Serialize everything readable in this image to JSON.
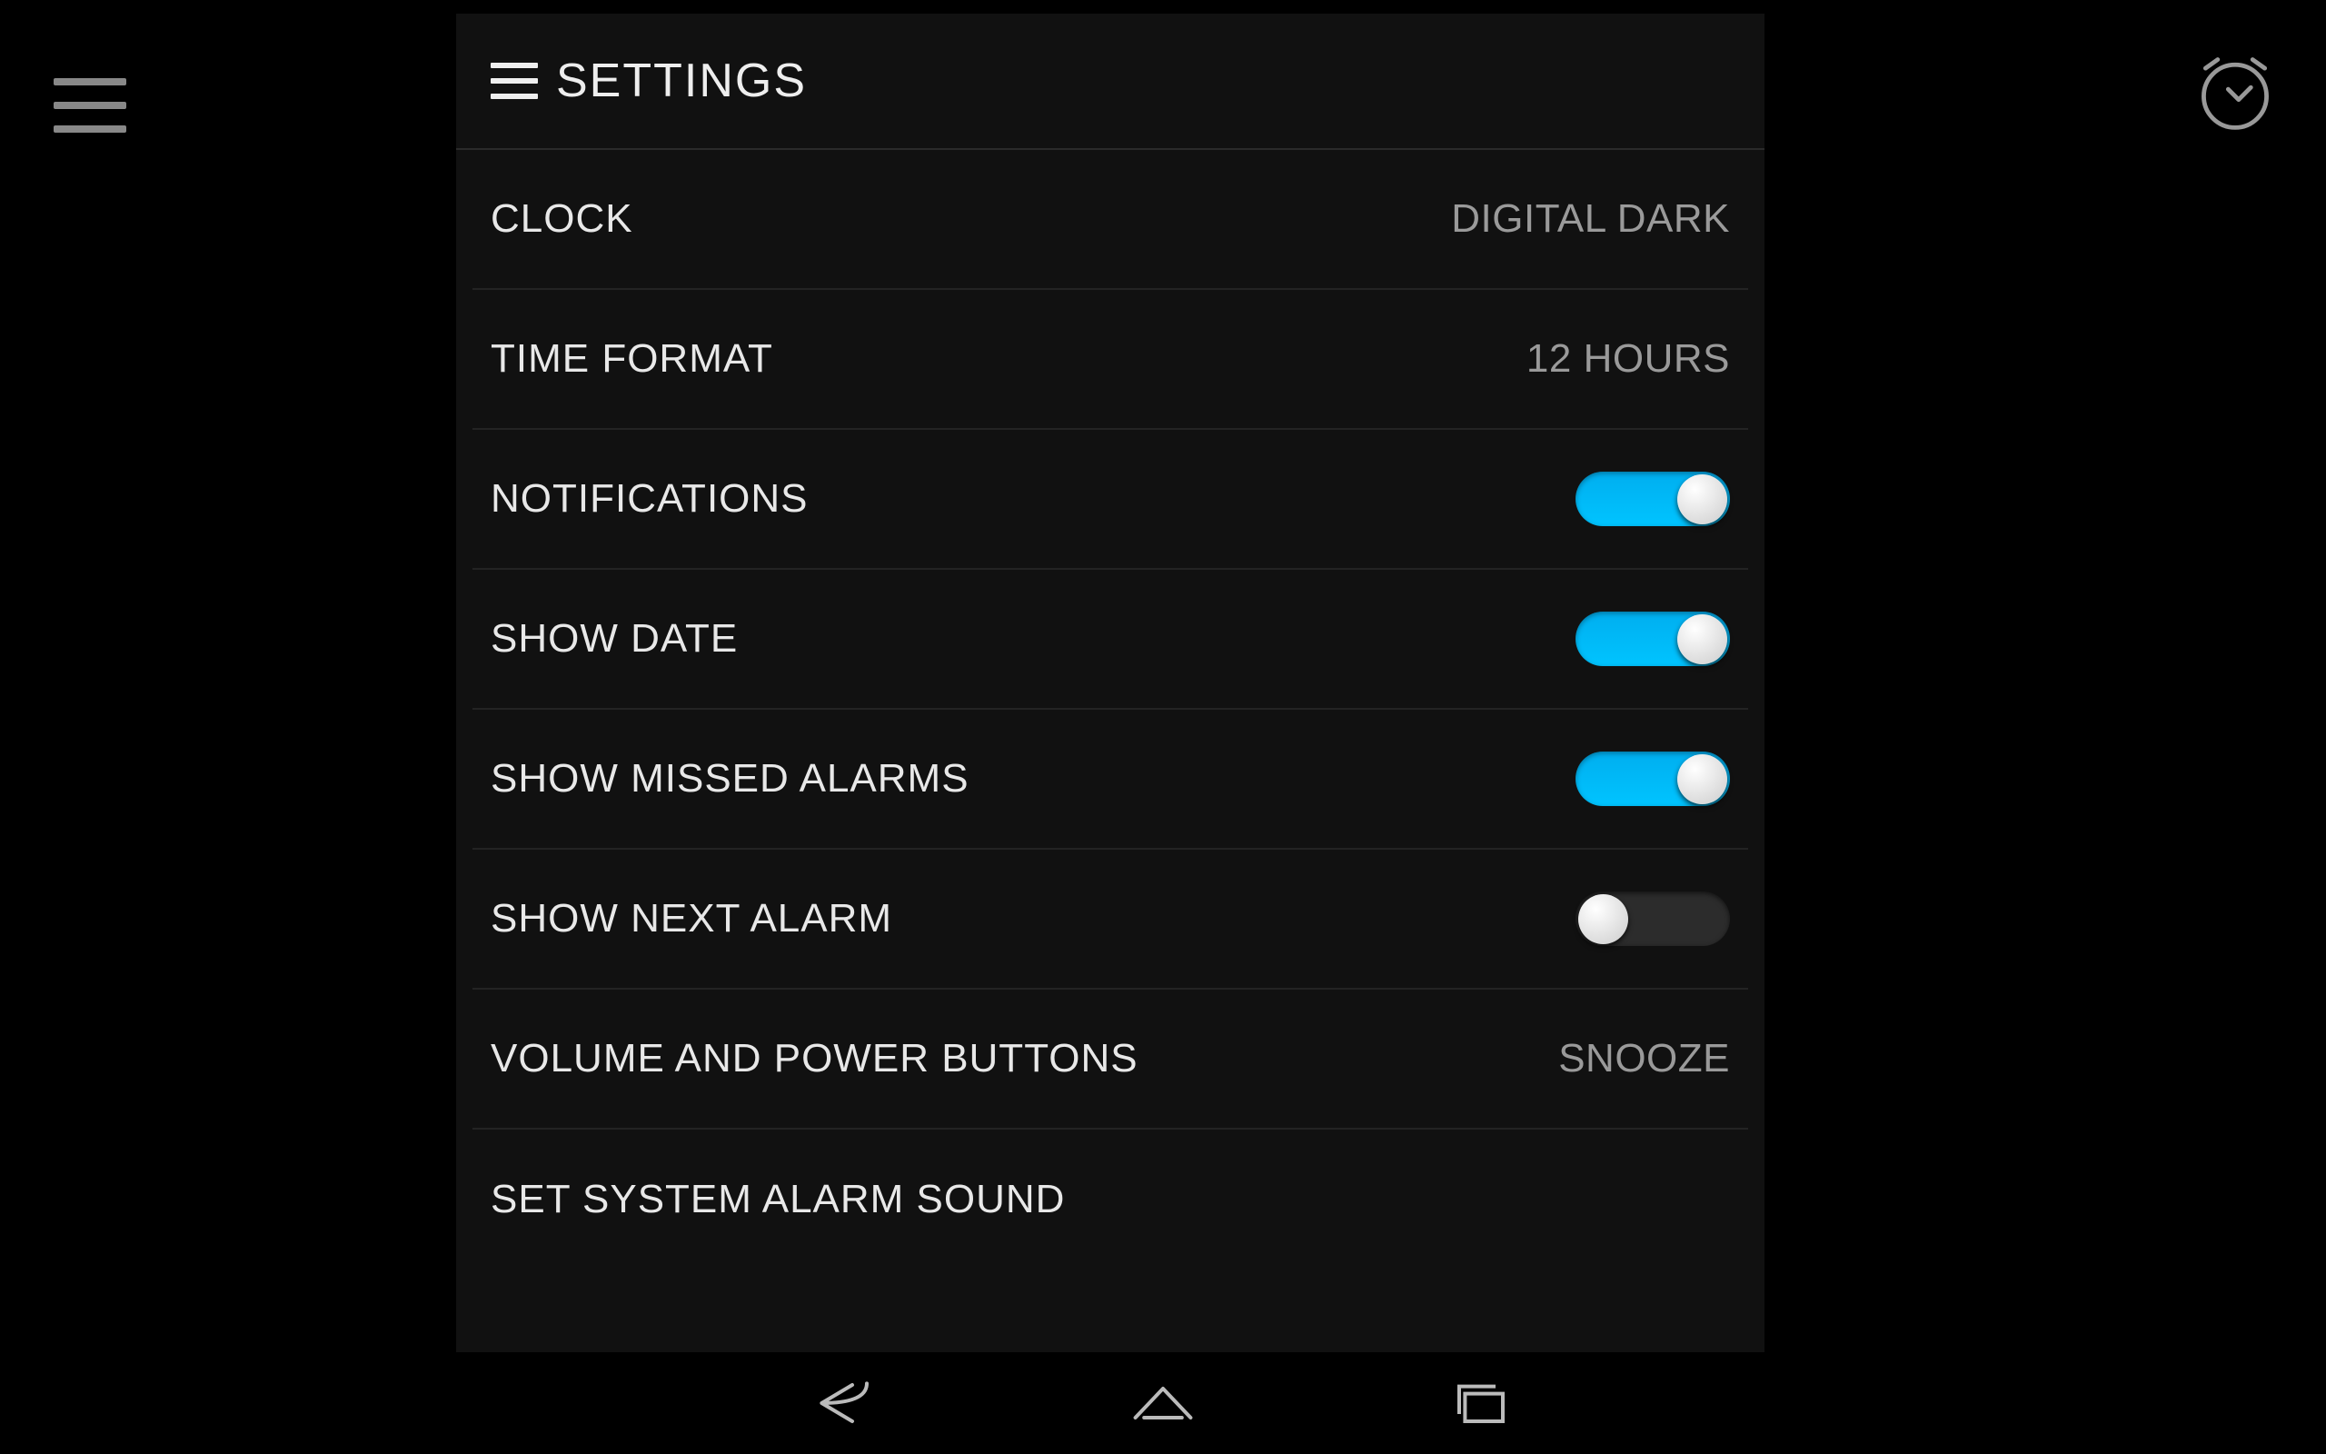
{
  "header": {
    "title": "SETTINGS"
  },
  "rows": {
    "clock": {
      "label": "CLOCK",
      "value": "DIGITAL DARK"
    },
    "time_format": {
      "label": "TIME FORMAT",
      "value": "12 HOURS"
    },
    "notifications": {
      "label": "NOTIFICATIONS",
      "on": true
    },
    "show_date": {
      "label": "SHOW DATE",
      "on": true
    },
    "show_missed": {
      "label": "SHOW MISSED ALARMS",
      "on": true
    },
    "show_next": {
      "label": "SHOW NEXT ALARM",
      "on": false
    },
    "vol_power": {
      "label": "VOLUME AND POWER BUTTONS",
      "value": "SNOOZE"
    },
    "system_sound": {
      "label": "SET SYSTEM ALARM SOUND"
    }
  },
  "icons": {
    "app_menu": "hamburger-icon",
    "alarm": "alarm-clock-icon",
    "nav_back": "back-icon",
    "nav_home": "home-icon",
    "nav_recents": "recents-icon"
  },
  "colors": {
    "accent_on": "#00c4ff",
    "bg": "#000000",
    "panel_bg": "#111111",
    "text_primary": "#e8e8e8",
    "text_secondary": "#9a9a9a"
  }
}
